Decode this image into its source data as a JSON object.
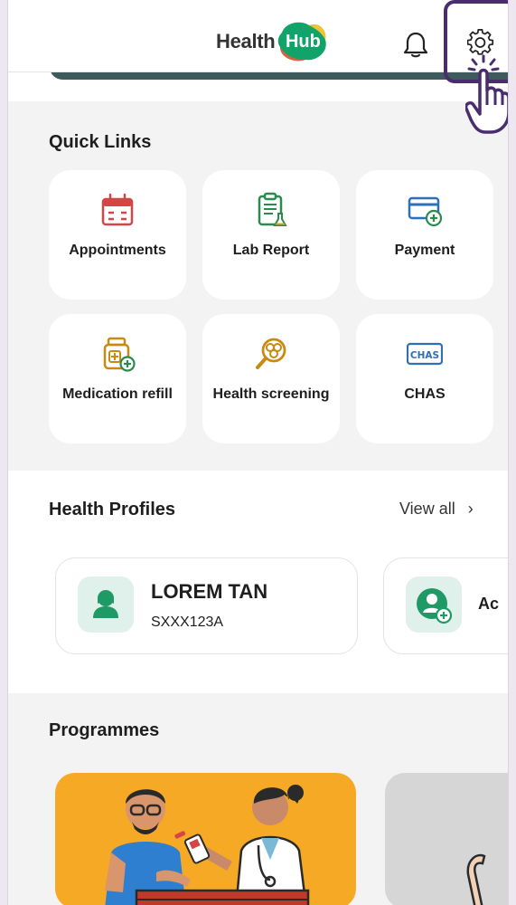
{
  "header": {
    "logo_word": "Health",
    "logo_badge": "Hub",
    "bell_icon": "bell-icon",
    "settings_icon": "gear-icon"
  },
  "overlay": {
    "highlight_color": "#4a2d6e",
    "pointer_icon": "hand-pointer-icon"
  },
  "quick_links": {
    "title": "Quick Links",
    "items": [
      {
        "label": "Appointments",
        "icon": "calendar-icon"
      },
      {
        "label": "Lab Report",
        "icon": "clipboard-flask-icon"
      },
      {
        "label": "Payment",
        "icon": "card-plus-icon"
      },
      {
        "label": "Medication refill",
        "icon": "pill-bottle-plus-icon"
      },
      {
        "label": "Health screening",
        "icon": "magnifier-cells-icon"
      },
      {
        "label": "CHAS",
        "icon": "chas-card-icon"
      }
    ],
    "chas_badge": "CHAS"
  },
  "health_profiles": {
    "title": "Health Profiles",
    "view_all": "View all",
    "profiles": [
      {
        "name": "LOREM TAN",
        "id": "SXXX123A",
        "icon": "person-icon"
      },
      {
        "name": "Ac",
        "icon": "add-person-icon"
      }
    ]
  },
  "programmes": {
    "title": "Programmes"
  },
  "colors": {
    "brand_green": "#12a36b",
    "icon_red": "#d64545",
    "icon_green": "#2d8a4e",
    "icon_blue": "#2f6fb5",
    "icon_gold": "#c98a12",
    "banner": "#f6a924"
  }
}
